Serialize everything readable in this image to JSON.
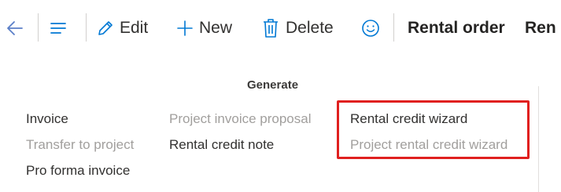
{
  "toolbar": {
    "back_label": "",
    "edit_label": "Edit",
    "new_label": "New",
    "delete_label": "Delete",
    "active_tab_label": "Rental order",
    "next_tab_partial": "Ren"
  },
  "menu": {
    "group_title": "Generate",
    "columns": [
      {
        "items": [
          {
            "label": "Invoice",
            "enabled": true
          },
          {
            "label": "Transfer to project",
            "enabled": false
          },
          {
            "label": "Pro forma invoice",
            "enabled": true
          }
        ]
      },
      {
        "items": [
          {
            "label": "Project invoice proposal",
            "enabled": false
          },
          {
            "label": "Rental credit note",
            "enabled": true
          }
        ]
      },
      {
        "items": [
          {
            "label": "Rental credit wizard",
            "enabled": true
          },
          {
            "label": "Project rental credit wizard",
            "enabled": false
          }
        ]
      }
    ]
  },
  "colors": {
    "accent": "#0078d4",
    "highlight": "#e0201f",
    "disabled_text": "#a19f9d"
  },
  "icons": [
    "back-arrow-icon",
    "hamburger-menu-icon",
    "pencil-icon",
    "plus-icon",
    "trash-icon",
    "smiley-icon"
  ]
}
